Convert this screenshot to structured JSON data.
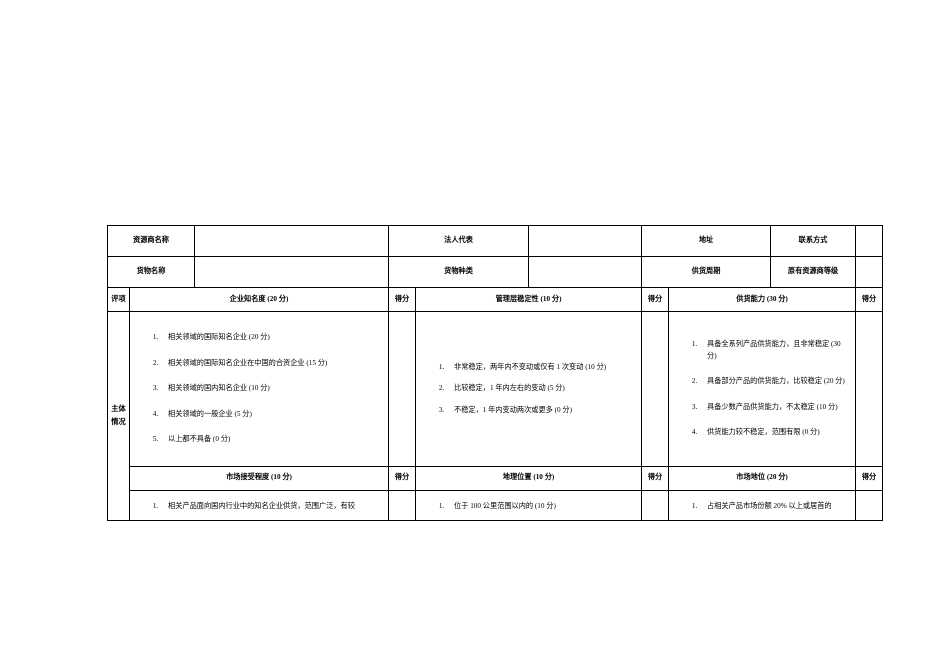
{
  "header": {
    "r1": {
      "c1_label": "资源商名称",
      "c1_value": "",
      "c2_label": "法人代表",
      "c2_value": "",
      "c3_label": "地址",
      "c3_value": "",
      "c4_label": "联系方式",
      "c4_value": ""
    },
    "r2": {
      "c1_label": "货物名称",
      "c1_value": "",
      "c2_label": "货物种类",
      "c2_value": "",
      "c3_label": "供货周期",
      "c3_value": "",
      "c4_label": "原有资源商等级",
      "c4_value": ""
    }
  },
  "criteria_row": {
    "left_header": "评项",
    "score_label": "得分",
    "c1": "企业知名度 (20 分)",
    "c2": "管理层稳定性 (10 分)",
    "c3": "供货能力 (30 分)"
  },
  "side_label": "主体情况",
  "block1": {
    "fame": [
      "相关领域的国际知名企业 (20 分)",
      "相关领域的国际知名企业在中国的合资企业 (15 分)",
      "相关领域的国内知名企业 (10 分)",
      "相关领域的一般企业 (5 分)",
      "以上都不具备 (0 分)"
    ],
    "stability": [
      "非常稳定，两年内不变动或仅有 1 次变动 (10 分)",
      "比较稳定，1 年内左右的变动 (5 分)",
      "不稳定，1 年内变动两次或更多 (0 分)"
    ],
    "supply": [
      "具备全系列产品供货能力，且非常稳定 (30 分)",
      "具备部分产品的供货能力，比较稳定 (20 分)",
      "具备少数产品供货能力，不太稳定 (10 分)",
      "供货能力较不稳定，范围有限 (0 分)"
    ]
  },
  "criteria_row2": {
    "c1": "市场接受程度 (10 分)",
    "c2": "地理位置 (10 分)",
    "c3": "市场地位 (20 分)"
  },
  "block2": {
    "market_accept": [
      "相关产品面向国内行业中的知名企业供货，范围广泛，有较"
    ],
    "geo": [
      "位于 100 公里范围以内的 (10 分)"
    ],
    "market_pos": [
      "占相关产品市场份额 20% 以上或居首的"
    ]
  }
}
